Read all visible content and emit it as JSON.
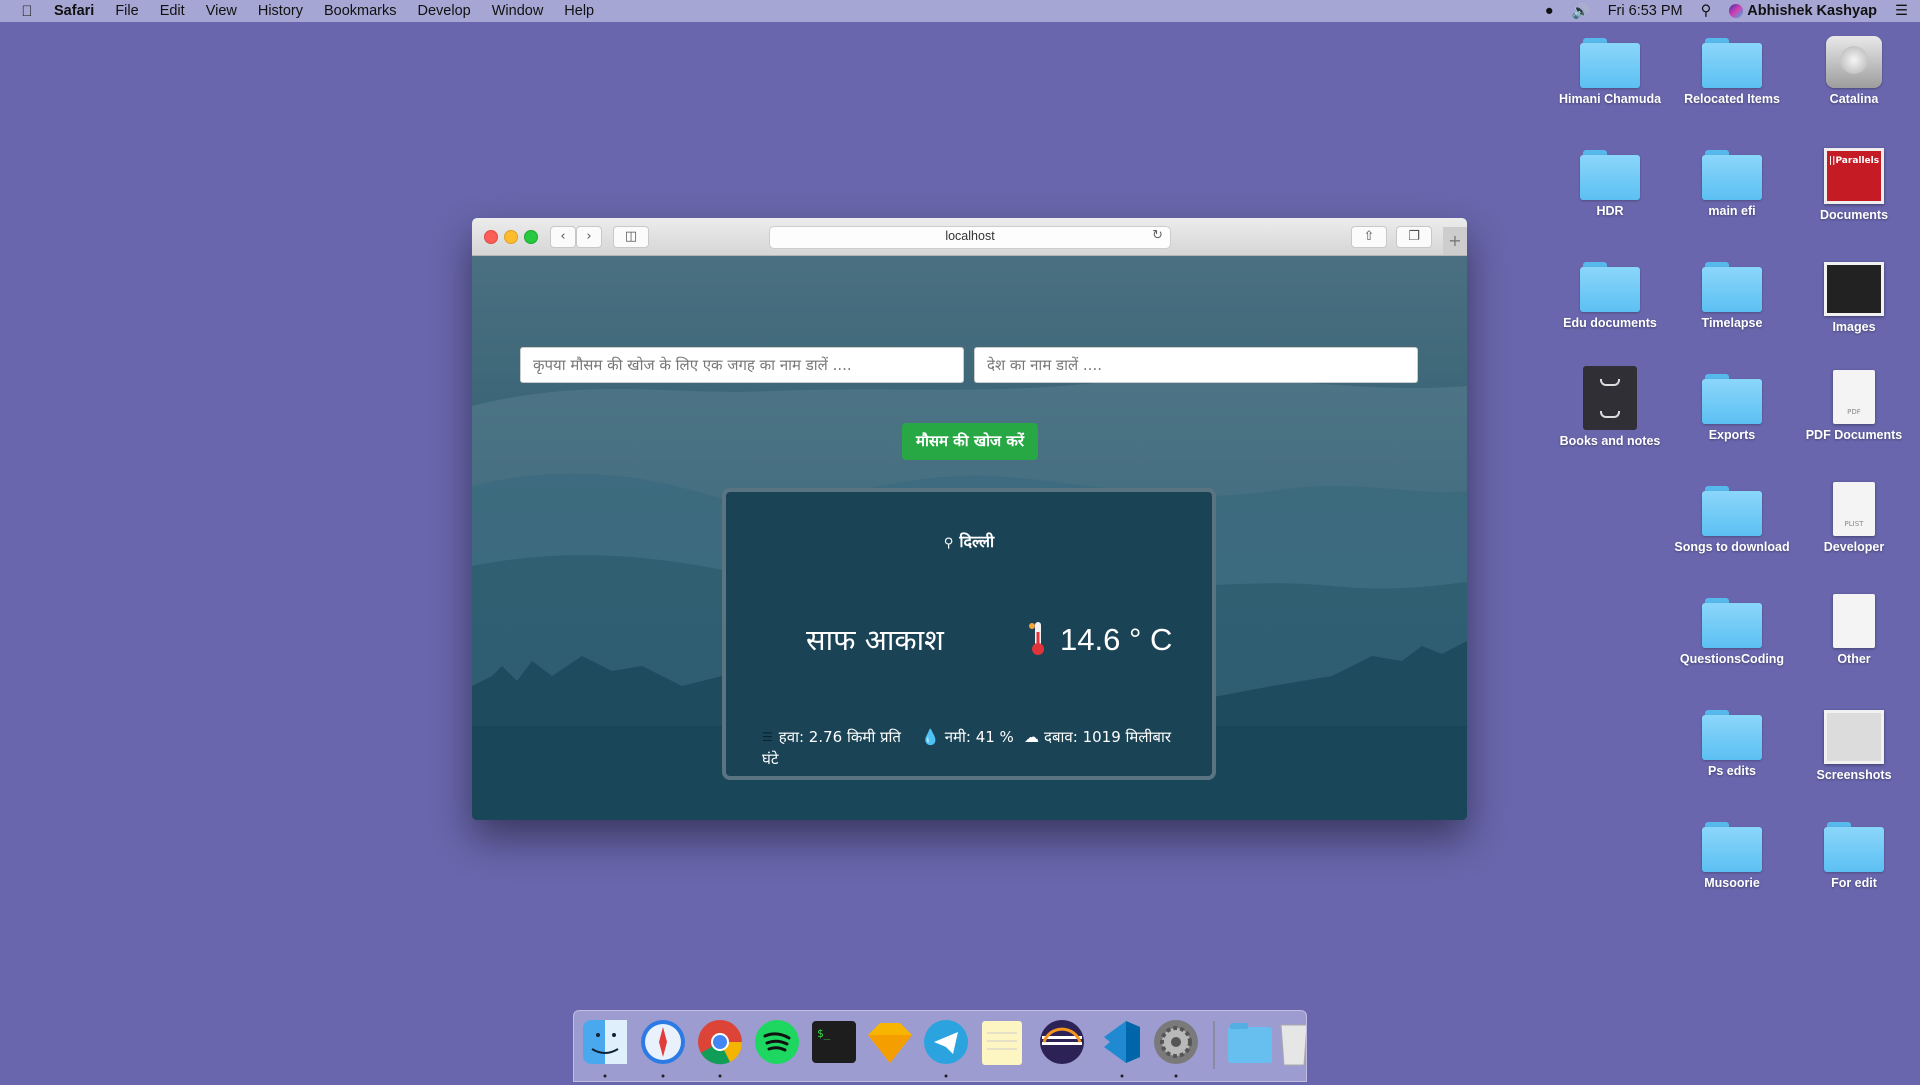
{
  "menubar": {
    "app": "Safari",
    "items": [
      "File",
      "Edit",
      "View",
      "History",
      "Bookmarks",
      "Develop",
      "Window",
      "Help"
    ],
    "clock": "Fri 6:53 PM",
    "user": "Abhishek Kashyap"
  },
  "desktop": {
    "icons": [
      {
        "label": "Himani Chamuda"
      },
      {
        "label": "Relocated Items"
      },
      {
        "label": "Catalina"
      },
      {
        "label": "HDR"
      },
      {
        "label": "main efi"
      },
      {
        "label": "Documents"
      },
      {
        "label": "Edu documents"
      },
      {
        "label": "Timelapse"
      },
      {
        "label": "Images"
      },
      {
        "label": "Books and notes"
      },
      {
        "label": "Exports"
      },
      {
        "label": "PDF Documents"
      },
      {
        "label": "Songs to download"
      },
      {
        "label": "Developer"
      },
      {
        "label": "QuestionsCoding"
      },
      {
        "label": "Other"
      },
      {
        "label": "Ps edits"
      },
      {
        "label": "Screenshots"
      },
      {
        "label": "Musoorie"
      },
      {
        "label": "For edit"
      }
    ]
  },
  "safari": {
    "address": "localhost",
    "parallels_text": "||Parallels",
    "pdf_text": "PDF",
    "plist_text": "PLIST"
  },
  "weather": {
    "place_placeholder": "कृपया मौसम की खोज के लिए एक जगह का नाम डालें ....",
    "country_placeholder": "देश का नाम डालें ....",
    "search_label": "मौसम की खोज करें",
    "city": "दिल्ली",
    "condition": "साफ आकाश",
    "temperature": "14.6 ° C",
    "wind": "हवा: 2.76 किमी प्रति घंटे",
    "humidity": "नमी: 41 %",
    "pressure": "दबाव: 1019 मिलीबार"
  },
  "colors": {
    "desktop": "#6966ad",
    "card": "#1a4356",
    "button": "#28a745"
  },
  "dock": {
    "apps": [
      "finder-icon",
      "safari-icon",
      "chrome-icon",
      "spotify-icon",
      "terminal-icon",
      "sketch-icon",
      "telegram-icon",
      "notes-icon",
      "eclipse-icon",
      "vscode-icon",
      "system-preferences-icon",
      "downloads-folder-icon",
      "trash-icon"
    ]
  }
}
